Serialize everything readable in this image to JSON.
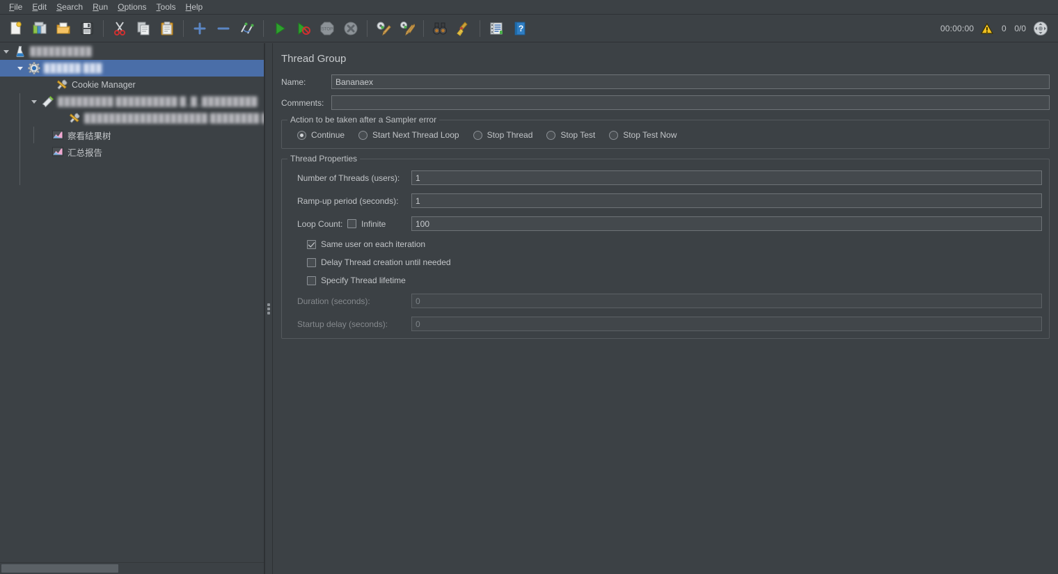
{
  "menu": {
    "items": [
      {
        "label": "File",
        "mnemonic": "F"
      },
      {
        "label": "Edit",
        "mnemonic": "E"
      },
      {
        "label": "Search",
        "mnemonic": "S"
      },
      {
        "label": "Run",
        "mnemonic": "R"
      },
      {
        "label": "Options",
        "mnemonic": "O"
      },
      {
        "label": "Tools",
        "mnemonic": "T"
      },
      {
        "label": "Help",
        "mnemonic": "H"
      }
    ]
  },
  "toolbar": {
    "buttons": [
      {
        "name": "new-icon",
        "tip": "New"
      },
      {
        "name": "templates-icon",
        "tip": "Templates"
      },
      {
        "name": "open-icon",
        "tip": "Open"
      },
      {
        "name": "save-icon",
        "tip": "Save Test Plan"
      },
      {
        "name": "cut-icon",
        "tip": "Cut"
      },
      {
        "name": "copy-icon",
        "tip": "Copy"
      },
      {
        "name": "paste-icon",
        "tip": "Paste"
      },
      {
        "name": "expand-all-icon",
        "tip": "Expand All"
      },
      {
        "name": "collapse-all-icon",
        "tip": "Collapse All"
      },
      {
        "name": "toggle-icon",
        "tip": "Toggle"
      },
      {
        "name": "start-icon",
        "tip": "Start"
      },
      {
        "name": "start-no-pauses-icon",
        "tip": "Start no pauses"
      },
      {
        "name": "stop-icon",
        "tip": "Stop"
      },
      {
        "name": "shutdown-icon",
        "tip": "Shutdown"
      },
      {
        "name": "clear-icon",
        "tip": "Clear"
      },
      {
        "name": "clear-all-icon",
        "tip": "Clear All"
      },
      {
        "name": "search-icon",
        "tip": "Search"
      },
      {
        "name": "search-reset-icon",
        "tip": "Reset Search"
      },
      {
        "name": "function-helper-icon",
        "tip": "Function Helper Dialog"
      },
      {
        "name": "help-icon",
        "tip": "Help"
      }
    ],
    "status": {
      "elapsed": "00:00:00",
      "warning_count": "0",
      "threads": "0/0"
    }
  },
  "tree": {
    "nodes": [
      {
        "name": "test-plan",
        "icon": "test-plan-icon",
        "label": "██████████",
        "blurred": true,
        "depth": 0,
        "twisty": "down",
        "selected": false
      },
      {
        "name": "thread-group",
        "icon": "thread-group-icon",
        "label": "██████ ███",
        "blurred": true,
        "depth": 1,
        "twisty": "down",
        "selected": true
      },
      {
        "name": "cookie-manager",
        "icon": "config-element-icon",
        "label": "Cookie Manager",
        "blurred": false,
        "depth": 2,
        "twisty": "none",
        "selected": false
      },
      {
        "name": "transaction-sampler",
        "icon": "sampler-icon",
        "label": "█████████ ██████████ █_█_█████████",
        "blurred": true,
        "depth": 2,
        "twisty": "down",
        "selected": false
      },
      {
        "name": "http-request",
        "icon": "config-element-icon",
        "label": "████████████████████ ████████ ████████████ █████",
        "blurred": true,
        "depth": 3,
        "twisty": "none",
        "selected": false
      },
      {
        "name": "view-results-tree",
        "icon": "listener-icon",
        "label": "察看结果树",
        "blurred": false,
        "depth": 2,
        "twisty": "none",
        "selected": false
      },
      {
        "name": "summary-report",
        "icon": "listener-icon",
        "label": "汇总报告",
        "blurred": false,
        "depth": 2,
        "twisty": "none",
        "selected": false
      }
    ]
  },
  "panel": {
    "title": "Thread Group",
    "name_label": "Name:",
    "name_value": "Bananaex",
    "comments_label": "Comments:",
    "comments_value": "",
    "error_action": {
      "title": "Action to be taken after a Sampler error",
      "selected": "Continue",
      "options": [
        {
          "label": "Continue",
          "selected": true
        },
        {
          "label": "Start Next Thread Loop",
          "selected": false
        },
        {
          "label": "Stop Thread",
          "selected": false
        },
        {
          "label": "Stop Test",
          "selected": false
        },
        {
          "label": "Stop Test Now",
          "selected": false
        }
      ]
    },
    "thread_properties": {
      "title": "Thread Properties",
      "num_threads_label": "Number of Threads (users):",
      "num_threads_value": "1",
      "ramp_up_label": "Ramp-up period (seconds):",
      "ramp_up_value": "1",
      "loop_count_label": "Loop Count:",
      "infinite_label": "Infinite",
      "infinite_checked": false,
      "loop_count_value": "100",
      "same_user_label": "Same user on each iteration",
      "same_user_checked": true,
      "delay_thread_label": "Delay Thread creation until needed",
      "delay_thread_checked": false,
      "specify_lifetime_label": "Specify Thread lifetime",
      "specify_lifetime_checked": false,
      "duration_label": "Duration (seconds):",
      "duration_value": "0",
      "duration_disabled": true,
      "startup_delay_label": "Startup delay (seconds):",
      "startup_delay_value": "0",
      "startup_delay_disabled": true
    }
  },
  "colors": {
    "background": "#3c4145",
    "field_background": "#44494d",
    "selection": "#4a6ea8",
    "text": "#c2c5c8",
    "border": "#6e7377",
    "disabled_text": "#85898d"
  }
}
